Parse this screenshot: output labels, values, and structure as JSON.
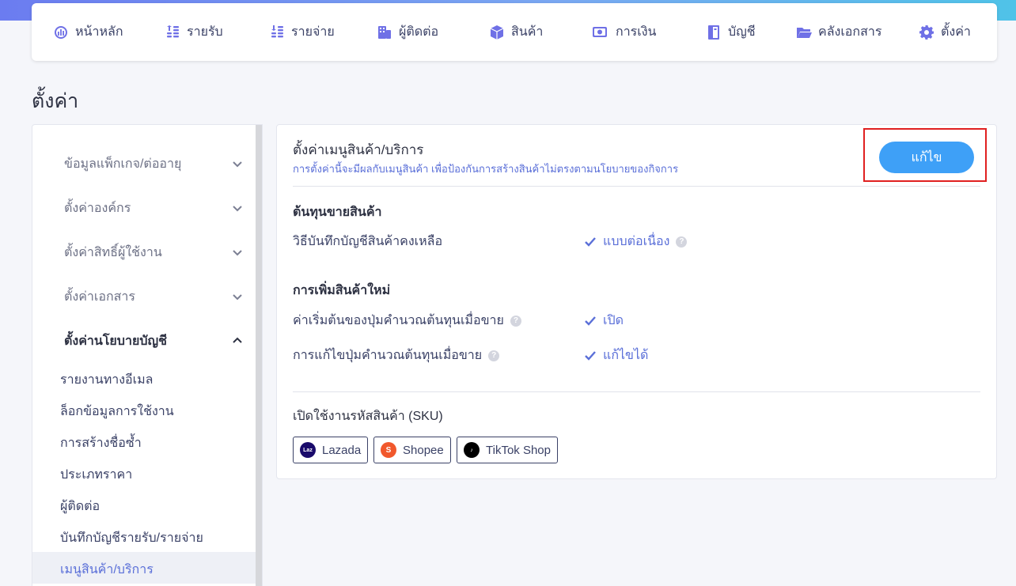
{
  "nav": [
    {
      "label": "หน้าหลัก",
      "icon": "dashboard-icon"
    },
    {
      "label": "รายรับ",
      "icon": "income-icon"
    },
    {
      "label": "รายจ่าย",
      "icon": "expense-icon"
    },
    {
      "label": "ผู้ติดต่อ",
      "icon": "contacts-icon"
    },
    {
      "label": "สินค้า",
      "icon": "box-icon"
    },
    {
      "label": "การเงิน",
      "icon": "money-icon"
    },
    {
      "label": "บัญชี",
      "icon": "ledger-icon"
    },
    {
      "label": "คลังเอกสาร",
      "icon": "folder-icon"
    },
    {
      "label": "ตั้งค่า",
      "icon": "gear-icon"
    }
  ],
  "page_title": "ตั้งค่า",
  "sidebar": {
    "sections": [
      {
        "label": "ข้อมูลแพ็กเกจ/ต่ออายุ",
        "expanded": false
      },
      {
        "label": "ตั้งค่าองค์กร",
        "expanded": false
      },
      {
        "label": "ตั้งค่าสิทธิ์ผู้ใช้งาน",
        "expanded": false
      },
      {
        "label": "ตั้งค่าเอกสาร",
        "expanded": false
      },
      {
        "label": "ตั้งค่านโยบายบัญชี",
        "expanded": true
      }
    ],
    "subitems": [
      "รายงานทางอีเมล",
      "ล็อกข้อมูลการใช้งาน",
      "การสร้างชื่อซ้ำ",
      "ประเภทราคา",
      "ผู้ติดต่อ",
      "บันทึกบัญชีรายรับ/รายจ่าย",
      "เมนูสินค้า/บริการ"
    ],
    "active_subitem": "เมนูสินค้า/บริการ"
  },
  "panel": {
    "title": "ตั้งค่าเมนูสินค้า/บริการ",
    "description": "การตั้งค่านี้จะมีผลกับเมนูสินค้า เพื่อป้องกันการสร้างสินค้าไม่ตรงตามนโยบายของกิจการ",
    "edit_label": "แก้ไข",
    "cost_section": {
      "heading": "ต้นทุนขายสินค้า",
      "rows": [
        {
          "label": "วิธีบันทึกบัญชีสินค้าคงเหลือ",
          "value": "แบบต่อเนื่อง",
          "label_help": false,
          "value_help": true
        }
      ]
    },
    "new_product_section": {
      "heading": "การเพิ่มสินค้าใหม่",
      "rows": [
        {
          "label": "ค่าเริ่มต้นของปุ่มคำนวณต้นทุนเมื่อขาย",
          "value": "เปิด",
          "label_help": true,
          "value_help": false
        },
        {
          "label": "การแก้ไขปุ่มคำนวณต้นทุนเมื่อขาย",
          "value": "แก้ไขได้",
          "label_help": true,
          "value_help": false
        }
      ]
    },
    "sku_section": {
      "heading": "เปิดใช้งานรหัสสินค้า (SKU)",
      "channels": [
        {
          "label": "Lazada",
          "icon": "lazada-logo-icon",
          "color": "#1a0b6b"
        },
        {
          "label": "Shopee",
          "icon": "shopee-logo-icon",
          "color": "#f1582c"
        },
        {
          "label": "TikTok Shop",
          "icon": "tiktok-logo-icon",
          "color": "#000000"
        }
      ]
    },
    "help_glyph": "?"
  },
  "colors": {
    "accent": "#6f70e6",
    "link": "#5a6fd8",
    "button": "#3ea0f7",
    "highlight_frame": "#e02020"
  }
}
